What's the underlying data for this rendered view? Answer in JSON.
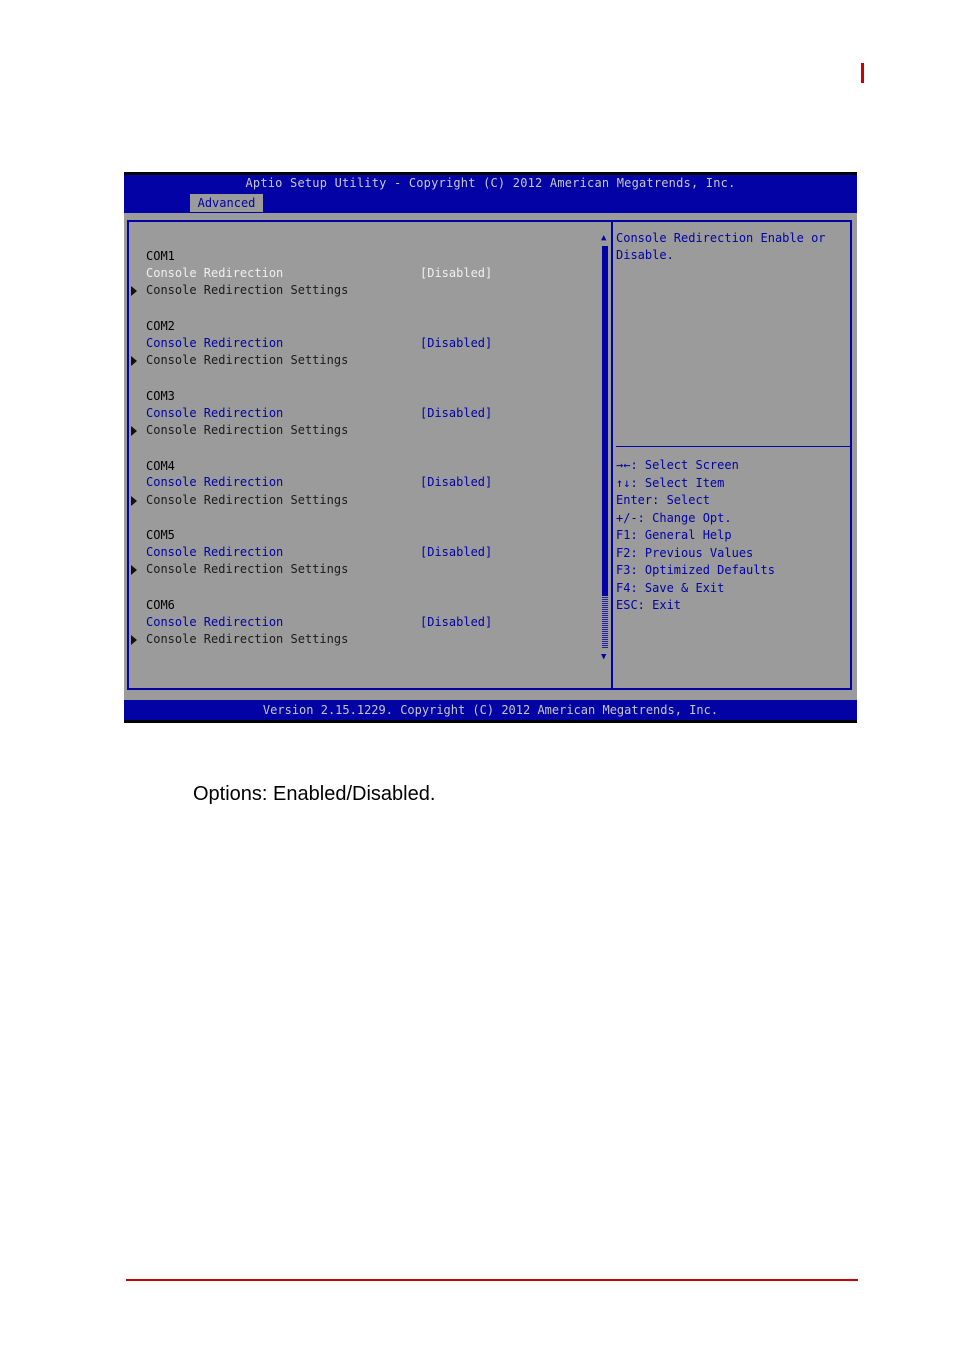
{
  "bios": {
    "title": "Aptio Setup Utility - Copyright (C) 2012 American Megatrends, Inc.",
    "active_tab": "Advanced",
    "footer": "Version 2.15.1229. Copyright (C) 2012 American Megatrends, Inc.",
    "ports": [
      {
        "name": "COM1",
        "option_label": "Console Redirection",
        "option_value": "[Disabled]",
        "submenu_label": "Console Redirection Settings",
        "selected": true
      },
      {
        "name": "COM2",
        "option_label": "Console Redirection",
        "option_value": "[Disabled]",
        "submenu_label": "Console Redirection Settings",
        "selected": false
      },
      {
        "name": "COM3",
        "option_label": "Console Redirection",
        "option_value": "[Disabled]",
        "submenu_label": "Console Redirection Settings",
        "selected": false
      },
      {
        "name": "COM4",
        "option_label": "Console Redirection",
        "option_value": "[Disabled]",
        "submenu_label": "Console Redirection Settings",
        "selected": false
      },
      {
        "name": "COM5",
        "option_label": "Console Redirection",
        "option_value": "[Disabled]",
        "submenu_label": "Console Redirection Settings",
        "selected": false
      },
      {
        "name": "COM6",
        "option_label": "Console Redirection",
        "option_value": "[Disabled]",
        "submenu_label": "Console Redirection Settings",
        "selected": false
      }
    ],
    "help": {
      "line1": "Console Redirection Enable or",
      "line2": "Disable."
    },
    "keys": [
      "→←: Select Screen",
      "↑↓: Select Item",
      "Enter: Select",
      "+/-: Change Opt.",
      "F1: General Help",
      "F2: Previous Values",
      "F3: Optimized Defaults",
      "F4: Save & Exit",
      "ESC: Exit"
    ],
    "scroll_up_icon": "▲",
    "scroll_down_icon": "▼",
    "colors": {
      "bios_blue": "#0202a5",
      "bios_gray": "#9b9b9b",
      "accent_red": "#cc0000"
    }
  },
  "document": {
    "options_text": "Options: Enabled/Disabled."
  }
}
